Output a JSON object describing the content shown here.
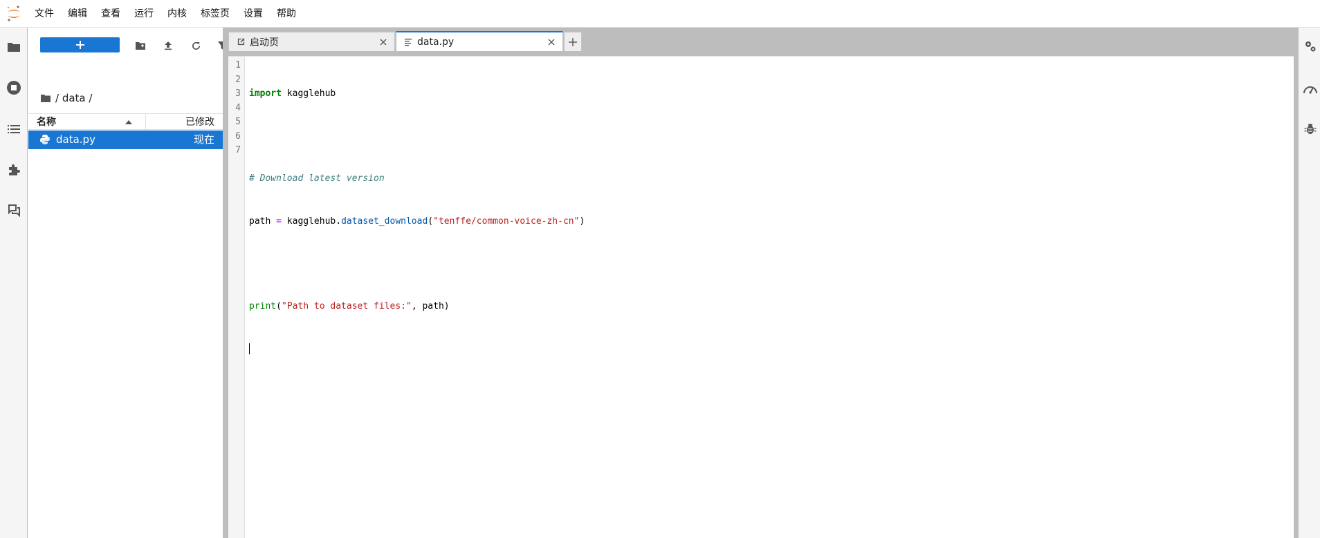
{
  "menubar": {
    "items": [
      "文件",
      "编辑",
      "查看",
      "运行",
      "内核",
      "标签页",
      "设置",
      "帮助"
    ]
  },
  "filebrowser": {
    "breadcrumb": "/ data /",
    "columns": {
      "name": "名称",
      "modified": "已修改"
    },
    "files": [
      {
        "name": "data.py",
        "modified": "现在",
        "icon": "python-icon"
      }
    ]
  },
  "tabs": [
    {
      "label": "启动页",
      "icon": "launcher-icon",
      "active": false
    },
    {
      "label": "data.py",
      "icon": "text-file-icon",
      "active": true
    }
  ],
  "editor": {
    "line_numbers": [
      "1",
      "2",
      "3",
      "4",
      "5",
      "6",
      "7"
    ],
    "code": {
      "l1_kw": "import",
      "l1_rest": " kagglehub",
      "l3_comment": "# Download latest version",
      "l4_a": "path ",
      "l4_op": "=",
      "l4_b": " kagglehub.",
      "l4_fn": "dataset_download",
      "l4_c": "(",
      "l4_str": "\"tenffe/common-voice-zh-cn\"",
      "l4_d": ")",
      "l6_fn": "print",
      "l6_a": "(",
      "l6_str": "\"Path to dataset files:\"",
      "l6_b": ", path)"
    }
  },
  "colors": {
    "accent": "#1976d2",
    "logo": "#f37726"
  }
}
